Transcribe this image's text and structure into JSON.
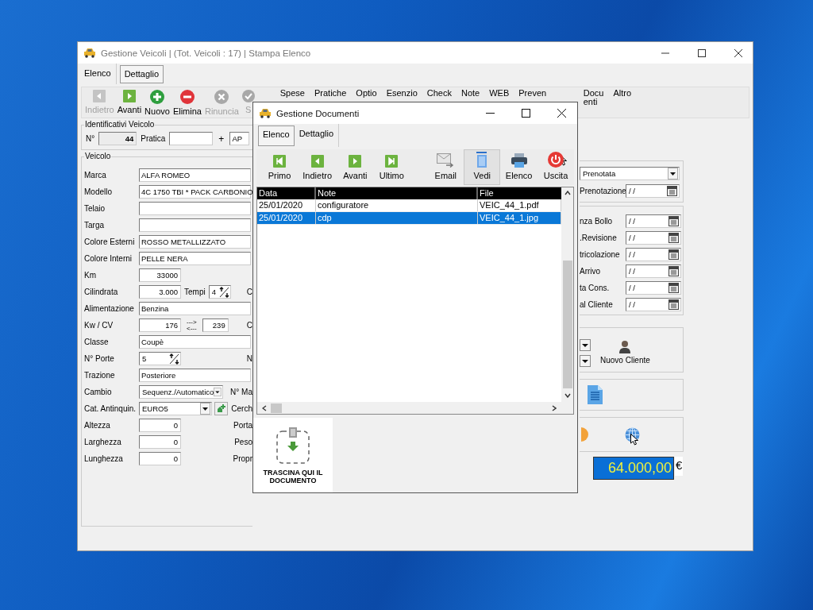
{
  "main_window": {
    "title": "Gestione Veicoli | (Tot. Veicoli : 17) | Stampa Elenco",
    "tabs": [
      {
        "label": "Elenco",
        "selected": false
      },
      {
        "label": "Dettaglio",
        "selected": true
      }
    ],
    "toolbar": [
      {
        "kind": "prev",
        "label": "Indietro",
        "disabled": true
      },
      {
        "kind": "next",
        "label": "Avanti",
        "disabled": false
      },
      {
        "kind": "add",
        "label": "Nuovo",
        "disabled": false
      },
      {
        "kind": "delete",
        "label": "Elimina",
        "disabled": false
      },
      {
        "kind": "cancel",
        "label": "Rinuncia",
        "disabled": true
      },
      {
        "kind": "confirm",
        "label": "S",
        "disabled": true
      },
      {
        "kind": "text",
        "label": "Spese",
        "disabled": false
      },
      {
        "kind": "text",
        "label": "Pratiche",
        "disabled": false
      },
      {
        "kind": "text",
        "label": "Optio",
        "disabled": false
      },
      {
        "kind": "text",
        "label": "Esenzio",
        "disabled": false
      },
      {
        "kind": "text",
        "label": "Check",
        "disabled": false
      },
      {
        "kind": "text",
        "label": "Note",
        "disabled": false
      },
      {
        "kind": "text",
        "label": "WEB",
        "disabled": false
      },
      {
        "kind": "text",
        "label": "Preven",
        "disabled": false
      },
      {
        "kind": "text",
        "label": "Docu\nenti",
        "disabled": false
      },
      {
        "kind": "text",
        "label": "Altro",
        "disabled": false
      }
    ],
    "identifiers": {
      "title": "Identificativi Veicolo",
      "number_label": "N°",
      "number": "44",
      "file_label": "Pratica",
      "plus": "+",
      "suffix": "AP"
    },
    "vehicle": {
      "title": "Veicolo",
      "rows": [
        {
          "label": "Marca",
          "kind": "wide",
          "value": "ALFA ROMEO"
        },
        {
          "label": "Modello",
          "kind": "wide",
          "value": "4C 1750 TBI * PACK CARBONIO"
        },
        {
          "label": "Telaio",
          "kind": "wide"
        },
        {
          "label": "Targa",
          "kind": "wide"
        },
        {
          "label": "Colore Esterni",
          "kind": "wide",
          "value": "ROSSO METALLIZZATO"
        },
        {
          "label": "Colore Interni",
          "kind": "wide",
          "value": "PELLE NERA"
        },
        {
          "label": "Km",
          "kind": "number",
          "value": "33000"
        },
        {
          "label": "Cilindrata",
          "kind": "number",
          "value": "3.000",
          "extra": {
            "label": "Tempi",
            "value": "4"
          },
          "side": "C"
        },
        {
          "label": "Alimentazione",
          "kind": "wide",
          "value": "Benzina"
        },
        {
          "label": "Kw / CV",
          "kind": "number",
          "value": "176",
          "convert": {
            "forward": "--->",
            "back": "<---",
            "value": "239"
          },
          "side": "C"
        },
        {
          "label": "Classe",
          "kind": "wide",
          "value": "Coupè"
        },
        {
          "label": "N° Porte",
          "kind": "spinner",
          "value": "5",
          "side": "N"
        },
        {
          "label": "Trazione",
          "kind": "wide",
          "value": "Posteriore"
        },
        {
          "label": "Cambio",
          "kind": "combo",
          "value": "Sequenz./Automatico",
          "side": "N° Ma"
        },
        {
          "label": "Cat. Antinquin.",
          "kind": "combo",
          "value": "EURO5",
          "add_button": true,
          "side": "Cerch"
        },
        {
          "label": "Altezza",
          "kind": "number",
          "value": "0",
          "side": "Porta"
        },
        {
          "label": "Larghezza",
          "kind": "number",
          "value": "0",
          "side": "Peso"
        },
        {
          "label": "Lunghezza",
          "kind": "number",
          "value": "0",
          "side": "Propr"
        }
      ]
    },
    "status": {
      "value": "Prenotata",
      "date_label": "Prenotazione",
      "date": " / /"
    },
    "dates": [
      {
        "label": "nza Bollo",
        "value": " / /"
      },
      {
        "label": ".Revisione",
        "value": " / /"
      },
      {
        "label": "tricolazione",
        "value": " / /"
      },
      {
        "label": "Arrivo",
        "value": " / /"
      },
      {
        "label": "ta Cons.",
        "value": " / /"
      },
      {
        "label": "al Cliente",
        "value": " / /"
      }
    ],
    "new_client_button": "Nuovo Cliente",
    "price": {
      "value": "64.000,00",
      "currency": "€"
    }
  },
  "documents_dialog": {
    "title": "Gestione Documenti",
    "tabs": [
      {
        "label": "Elenco",
        "selected": true
      },
      {
        "label": "Dettaglio",
        "selected": false
      }
    ],
    "toolbar": [
      {
        "kind": "first",
        "label": "Primo",
        "hovered": false
      },
      {
        "kind": "prev",
        "label": "Indietro",
        "hovered": false
      },
      {
        "kind": "next",
        "label": "Avanti",
        "hovered": false
      },
      {
        "kind": "last",
        "label": "Ultimo",
        "hovered": false
      },
      {
        "kind": "email",
        "label": "Email",
        "hovered": false
      },
      {
        "kind": "view",
        "label": "Vedi",
        "hovered": true
      },
      {
        "kind": "print",
        "label": "Elenco",
        "hovered": false
      },
      {
        "kind": "exit",
        "label": "Uscita",
        "hovered": false
      }
    ],
    "table": {
      "columns": [
        "Data",
        "Note",
        "File"
      ],
      "rows": [
        {
          "date": "25/01/2020",
          "note": "configuratore",
          "file": "VEIC_44_1.pdf",
          "selected": false
        },
        {
          "date": "25/01/2020",
          "note": "cdp",
          "file": "VEIC_44_1.jpg",
          "selected": true
        }
      ]
    },
    "drop_zone": {
      "label": "TRASCINA QUI IL DOCUMENTO"
    }
  }
}
